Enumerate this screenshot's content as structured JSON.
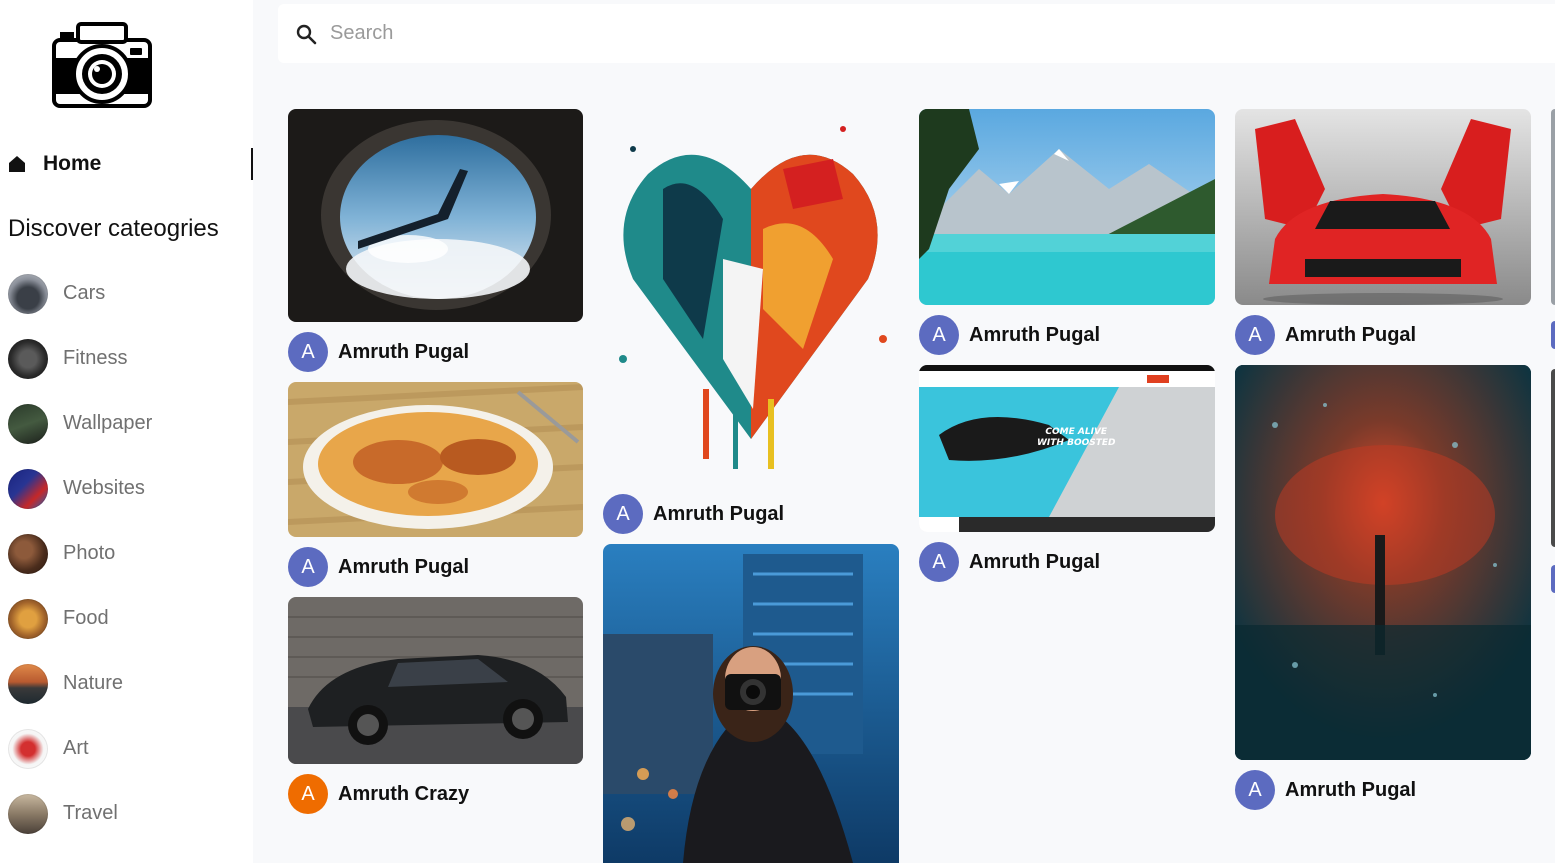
{
  "sidebar": {
    "home_label": "Home",
    "discover_title": "Discover cateogries",
    "categories": [
      {
        "label": "Cars",
        "thumb_icon": "car-thumbnail"
      },
      {
        "label": "Fitness",
        "thumb_icon": "fitness-thumbnail"
      },
      {
        "label": "Wallpaper",
        "thumb_icon": "wallpaper-thumbnail"
      },
      {
        "label": "Websites",
        "thumb_icon": "websites-thumbnail"
      },
      {
        "label": "Photo",
        "thumb_icon": "photo-thumbnail"
      },
      {
        "label": "Food",
        "thumb_icon": "food-thumbnail"
      },
      {
        "label": "Nature",
        "thumb_icon": "nature-thumbnail"
      },
      {
        "label": "Art",
        "thumb_icon": "art-thumbnail"
      },
      {
        "label": "Travel",
        "thumb_icon": "travel-thumbnail"
      }
    ]
  },
  "search": {
    "placeholder": "Search",
    "value": ""
  },
  "pins": [
    {
      "image": "airplane-window",
      "avatar_letter": "A",
      "author": "Amruth Pugal",
      "avatar_color": "#5c6bc0"
    },
    {
      "image": "biryani",
      "avatar_letter": "A",
      "author": "Amruth Pugal",
      "avatar_color": "#5c6bc0"
    },
    {
      "image": "black-ferrari",
      "avatar_letter": "A",
      "author": "Amruth Crazy",
      "avatar_color": "#ef6c00"
    },
    {
      "image": "paint-heart",
      "avatar_letter": "A",
      "author": "Amruth Pugal",
      "avatar_color": "#5c6bc0"
    },
    {
      "image": "photographer",
      "avatar_letter": "",
      "author": "",
      "avatar_color": "#5c6bc0"
    },
    {
      "image": "mountain-lake",
      "avatar_letter": "A",
      "author": "Amruth Pugal",
      "avatar_color": "#5c6bc0"
    },
    {
      "image": "website-screenshot",
      "avatar_letter": "A",
      "author": "Amruth Pugal",
      "avatar_color": "#5c6bc0"
    },
    {
      "image": "red-ferrari",
      "avatar_letter": "A",
      "author": "Amruth Pugal",
      "avatar_color": "#5c6bc0"
    },
    {
      "image": "rainy-tree",
      "avatar_letter": "A",
      "author": "Amruth Pugal",
      "avatar_color": "#5c6bc0"
    }
  ],
  "website_pin_text": {
    "headline_1": "COME ALIVE",
    "headline_2": "WITH BOOSTED"
  },
  "colors": {
    "avatar_blue": "#5c6bc0",
    "avatar_orange": "#ef6c00",
    "page_bg": "#f8f9fb"
  }
}
